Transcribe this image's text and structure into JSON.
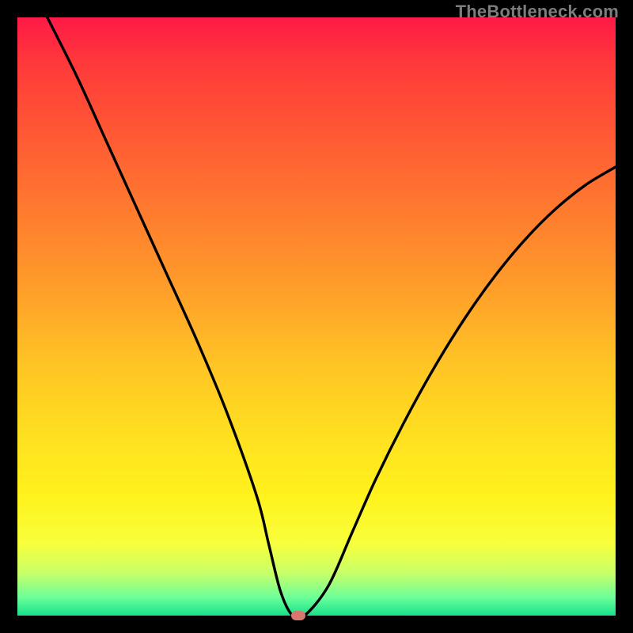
{
  "watermark": "TheBottleneck.com",
  "chart_data": {
    "type": "line",
    "title": "",
    "xlabel": "",
    "ylabel": "",
    "xlim": [
      0,
      100
    ],
    "ylim": [
      0,
      100
    ],
    "grid": false,
    "series": [
      {
        "name": "curve",
        "x": [
          5,
          10,
          15,
          20,
          25,
          30,
          35,
          40,
          42,
          44,
          46,
          48,
          52,
          56,
          60,
          65,
          70,
          75,
          80,
          85,
          90,
          95,
          100
        ],
        "values": [
          100,
          90,
          79,
          68,
          57,
          46,
          34,
          20,
          12,
          4,
          0,
          0,
          5,
          14,
          23,
          33,
          42,
          50,
          57,
          63,
          68,
          72,
          75
        ]
      }
    ],
    "marker": {
      "x": 47,
      "y": 0,
      "color": "#d9766e"
    },
    "background_gradient": {
      "top": "#ff1a47",
      "bottom": "#16e08a"
    },
    "line_color": "#000000",
    "line_width": 3
  }
}
